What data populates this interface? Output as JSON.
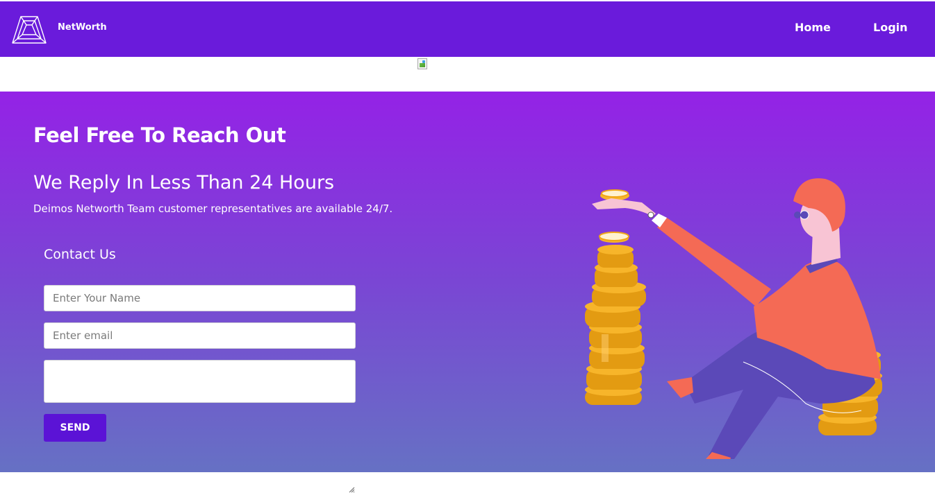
{
  "navbar": {
    "brand": "NetWorth",
    "links": [
      "Home",
      "Login"
    ]
  },
  "hero": {
    "title": "Feel Free To Reach Out",
    "subtitle": "We Reply In Less Than 24 Hours",
    "description": "Deimos Networth Team customer representatives are available 24/7."
  },
  "contact": {
    "heading": "Contact Us",
    "name_placeholder": "Enter Your Name",
    "email_placeholder": "Enter email",
    "message_placeholder": "",
    "send_label": "SEND"
  },
  "colors": {
    "navbar": "#6a1bdb",
    "gradient_top": "#9422e6",
    "gradient_bottom": "#6671c4",
    "button": "#5b13d6",
    "coins": "#f5a623",
    "figure": "#f46a55"
  },
  "icons": {
    "logo": "triangle-logo-icon",
    "broken_image": "broken-image-icon",
    "illustration": "coin-stacker-illustration"
  }
}
